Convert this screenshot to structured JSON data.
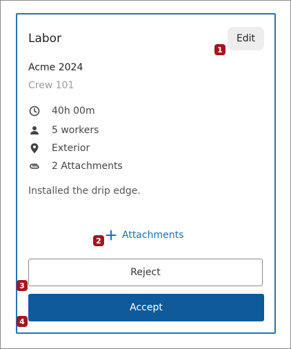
{
  "card": {
    "title": "Labor",
    "edit_label": "Edit",
    "project_name": "Acme 2024",
    "crew_name": "Crew 101",
    "details": [
      {
        "icon": "clock-icon",
        "text": "40h 00m"
      },
      {
        "icon": "person-icon",
        "text": "5 workers"
      },
      {
        "icon": "location-pin-icon",
        "text": "Exterior"
      },
      {
        "icon": "paperclip-icon",
        "text": "2 Attachments"
      }
    ],
    "note": "Installed the drip edge.",
    "add_attachments_label": "Attachments",
    "reject_label": "Reject",
    "accept_label": "Accept"
  },
  "badges": [
    "1",
    "2",
    "3",
    "4"
  ],
  "colors": {
    "border_accent": "#1f74b6",
    "link": "#1f6fb0",
    "primary_button": "#0e5a9a",
    "badge": "#a3161f"
  }
}
